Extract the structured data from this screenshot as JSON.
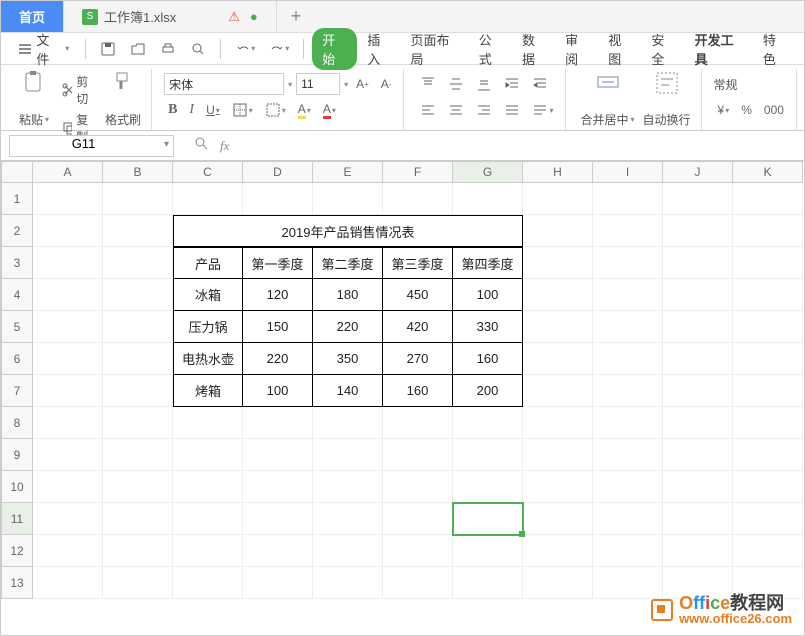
{
  "tabs": {
    "home": "首页",
    "file": "工作簿1.xlsx"
  },
  "menubar": {
    "file_label": "文件",
    "items": [
      "开始",
      "插入",
      "页面布局",
      "公式",
      "数据",
      "审阅",
      "视图",
      "安全",
      "开发工具",
      "特色"
    ]
  },
  "clipboard": {
    "paste": "粘贴",
    "cut": "剪切",
    "copy": "复制",
    "painter": "格式刷"
  },
  "font": {
    "name": "宋体",
    "size": "11",
    "bold": "B",
    "italic": "I",
    "underline": "U"
  },
  "align": {
    "merge": "合并居中",
    "wrap": "自动换行"
  },
  "numfmt": {
    "label": "常规"
  },
  "namebox": "G11",
  "columns": [
    "A",
    "B",
    "C",
    "D",
    "E",
    "F",
    "G",
    "H",
    "I",
    "J",
    "K"
  ],
  "chart_data": {
    "type": "table",
    "title": "2019年产品销售情况表",
    "headers": [
      "产品",
      "第一季度",
      "第二季度",
      "第三季度",
      "第四季度"
    ],
    "rows": [
      {
        "p": "冰箱",
        "v": [
          120,
          180,
          450,
          100
        ]
      },
      {
        "p": "压力锅",
        "v": [
          150,
          220,
          420,
          330
        ]
      },
      {
        "p": "电热水壶",
        "v": [
          220,
          350,
          270,
          160
        ]
      },
      {
        "p": "烤箱",
        "v": [
          100,
          140,
          160,
          200
        ]
      }
    ]
  },
  "selected": {
    "row": 11,
    "col": "G"
  },
  "watermark": {
    "brand": "Office教程网",
    "url": "www.office26.com"
  }
}
